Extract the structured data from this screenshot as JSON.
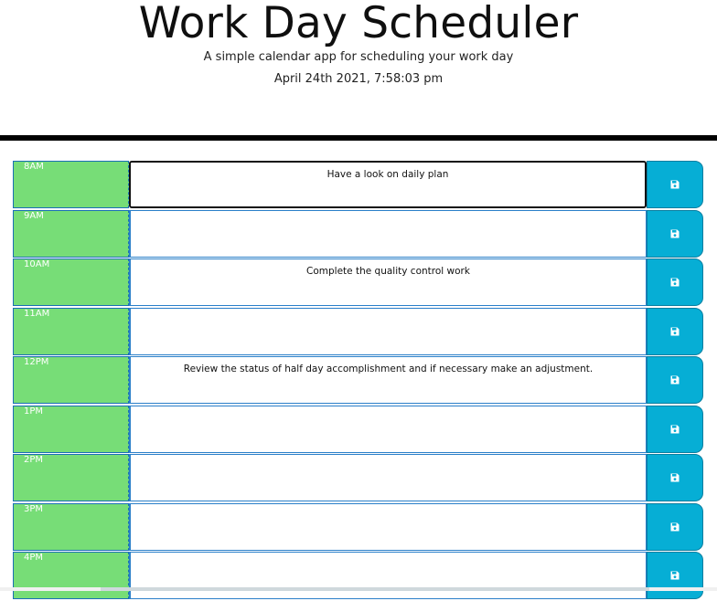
{
  "header": {
    "title": "Work Day Scheduler",
    "lead": "A simple calendar app for scheduling your work day",
    "current_day": "April 24th 2021, 7:58:03 pm"
  },
  "colors": {
    "hour_block": "#77dd77",
    "save_button": "#06aed5",
    "divider": "#000000"
  },
  "save_icon": "floppy-disk-icon",
  "rows": [
    {
      "hour": "8AM",
      "task": "Have a look on daily plan",
      "focused": true
    },
    {
      "hour": "9AM",
      "task": ""
    },
    {
      "hour": "10AM",
      "task": "Complete the quality control work"
    },
    {
      "hour": "11AM",
      "task": ""
    },
    {
      "hour": "12PM",
      "task": "Review the status of half day accomplishment and if necessary make an adjustment."
    },
    {
      "hour": "1PM",
      "task": ""
    },
    {
      "hour": "2PM",
      "task": ""
    },
    {
      "hour": "3PM",
      "task": ""
    },
    {
      "hour": "4PM",
      "task": ""
    }
  ]
}
